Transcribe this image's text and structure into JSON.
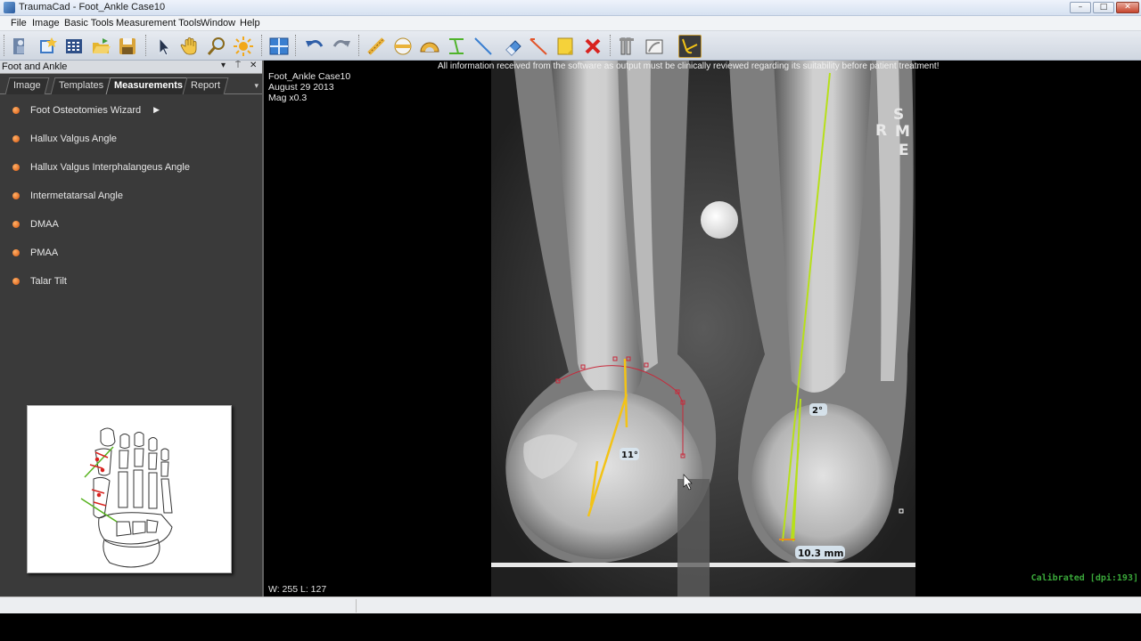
{
  "window": {
    "title": "TraumaCad - Foot_Ankle Case10",
    "minimize": "–",
    "maximize": "□",
    "close": "✕"
  },
  "menu": [
    "File",
    "Image",
    "Basic Tools",
    "Measurement Tools",
    "Window",
    "Help"
  ],
  "toolbar": {
    "icons": [
      "patient-icon",
      "new-icon",
      "grid-icon",
      "open-folder-icon",
      "save-icon",
      "pointer-icon",
      "hand-pan-icon",
      "zoom-icon",
      "brightness-icon",
      "layout-icon",
      "undo-icon",
      "redo-icon",
      "ruler-icon",
      "circle-icon",
      "protractor-icon",
      "parallel-lines-icon",
      "line-icon",
      "eraser-icon",
      "angle-line-icon",
      "note-icon",
      "delete-icon",
      "implant-icon",
      "template-icon",
      "foot-tool-icon"
    ],
    "active": "foot-tool-icon"
  },
  "panel": {
    "title": "Foot and Ankle",
    "pin": "▾",
    "dock": "⍑",
    "close": "✕",
    "tabs": [
      "Image",
      "Templates",
      "Measurements",
      "Report"
    ],
    "active_tab": "Measurements",
    "tab_menu": "▾",
    "measurements": [
      "Foot Osteotomies Wizard",
      "Hallux Valgus Angle",
      "Hallux Valgus Interphalangeus Angle",
      "Intermetatarsal Angle",
      "DMAA",
      "PMAA",
      "Talar Tilt"
    ],
    "wizard_arrow": "▶"
  },
  "viewer": {
    "case": "Foot_Ankle Case10",
    "date": "August 29 2013",
    "mag": "Mag x0.3",
    "disclaimer": "All information received from the software as output must be clinically reviewed regarding its suitability before patient treatment!",
    "orientation": [
      "S",
      "R",
      "M",
      "E"
    ],
    "angle_left": "11°",
    "angle_right": "2°",
    "distance": "10.3 mm",
    "window_level": "W: 255 L: 127",
    "calibration": "Calibrated [dpi:193]"
  },
  "colors": {
    "measure_yellow": "#f3c316",
    "measure_green": "#b7e01a",
    "arc_red": "#c8283a",
    "calib_green": "#3aa83a"
  }
}
